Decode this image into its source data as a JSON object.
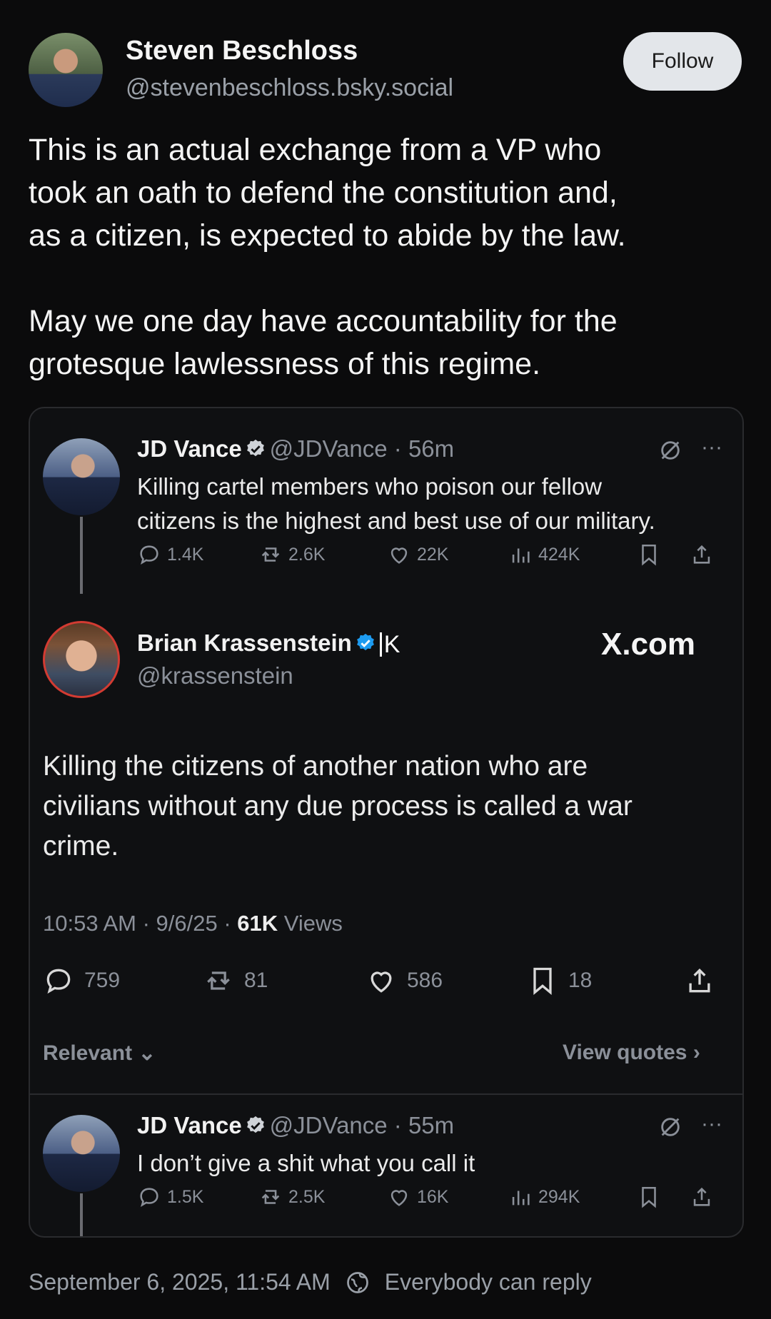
{
  "post": {
    "author_name": "Steven Beschloss",
    "author_handle": "@stevenbeschloss.bsky.social",
    "follow_label": "Follow",
    "text": "This is an actual exchange from a VP who\ntook an oath to defend the constitution and,\nas a citizen, is expected to abide by the law.\n\nMay we one day have accountability for the\ngrotesque lawlessness of this regime.",
    "timestamp": "September 6, 2025, 11:54 AM",
    "reply_setting": "Everybody can reply"
  },
  "embed": {
    "tweet1": {
      "name": "JD Vance",
      "handle": "@JDVance · 56m",
      "text_line1": "Killing cartel members who poison our fellow",
      "text_line2": "citizens is the highest and best use of our military.",
      "replies": "1.4K",
      "reposts": "2.6K",
      "likes": "22K",
      "views": "424K"
    },
    "tweet2": {
      "name": "Brian Krassenstein",
      "handle": "@krassenstein",
      "badge_letter": "K",
      "source": "X.com",
      "text": "Killing the citizens of another nation who are\ncivilians without any due process is called a war\ncrime.",
      "time": "10:53 AM · 9/6/25 · ",
      "views_count": "61K",
      "views_label": "Views",
      "replies": "759",
      "reposts": "81",
      "likes": "586",
      "bookmarks": "18",
      "sort_label": "Relevant",
      "view_quotes": "View quotes"
    },
    "tweet3": {
      "name": "JD Vance",
      "handle": "@JDVance · 55m",
      "text": "I don’t give a shit what you call it",
      "replies": "1.5K",
      "reposts": "2.5K",
      "likes": "16K",
      "views": "294K"
    }
  },
  "colors": {
    "background": "#0b0b0c",
    "verified": "#1d9bf0",
    "muted": "#8b9099"
  }
}
